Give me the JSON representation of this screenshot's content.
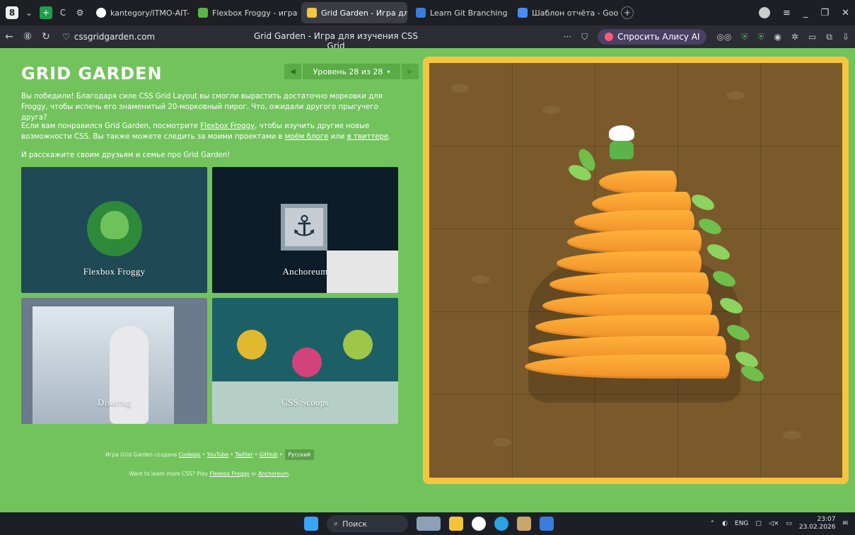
{
  "browser": {
    "tabs": [
      {
        "label": "kantegory/ITMO-AIT-F",
        "color": "#ffffff"
      },
      {
        "label": "Flexbox Froggy - игра дл",
        "color": "#5bb449"
      },
      {
        "label": "Grid Garden - Игра для",
        "color": "#f5c542",
        "active": true
      },
      {
        "label": "Learn Git Branching",
        "color": "#3b7ddd"
      },
      {
        "label": "Шаблон отчёта - Google",
        "color": "#4a8af4"
      }
    ],
    "address": "cssgridgarden.com",
    "page_title": "Grid Garden - Игра для изучения CSS Grid",
    "alice_label": "Спросить Алису AI"
  },
  "page": {
    "logo": "GRID GARDEN",
    "level_label": "Уровень 28 из 28",
    "win_text": "Вы победили! Благодаря силе CSS Grid Layout вы смогли вырастить достаточно морковки для Froggy, чтобы испечь его знаменитый 20-морковный пирог. Что, ожидали другого прыгучего друга?",
    "more_text_1": "Если вам понравился Grid Garden, посмотрите ",
    "more_link_1": "Flexbox Froggy",
    "more_text_2": ", чтобы изучить другие новые возможности CSS. Вы также можете следить за моими проектами в ",
    "more_link_2": "моём блоге",
    "more_text_3": " или ",
    "more_link_3": "в твиттере",
    "more_text_4": ".",
    "share_text": "И расскажите своим друзьям и семье про Grid Garden!",
    "cards": [
      {
        "label": "Flexbox Froggy"
      },
      {
        "label": "Anchoreum"
      },
      {
        "label": "Disarrag"
      },
      {
        "label": "CSS Scoops"
      }
    ],
    "footer_prefix": "Игра Grid Garden создана ",
    "footer_links": [
      "Codepip",
      "YouTube",
      "Twitter",
      "GitHub"
    ],
    "lang_button": "Русский",
    "footer2_prefix": "Want to learn more CSS? Play ",
    "footer2_link1": "Flexbox Froggy",
    "footer2_mid": " or ",
    "footer2_link2": "Anchoreum",
    "footer2_suffix": "."
  },
  "taskbar": {
    "search_placeholder": "Поиск",
    "lang": "ENG",
    "time": "23:07",
    "date": "23.02.2026"
  }
}
